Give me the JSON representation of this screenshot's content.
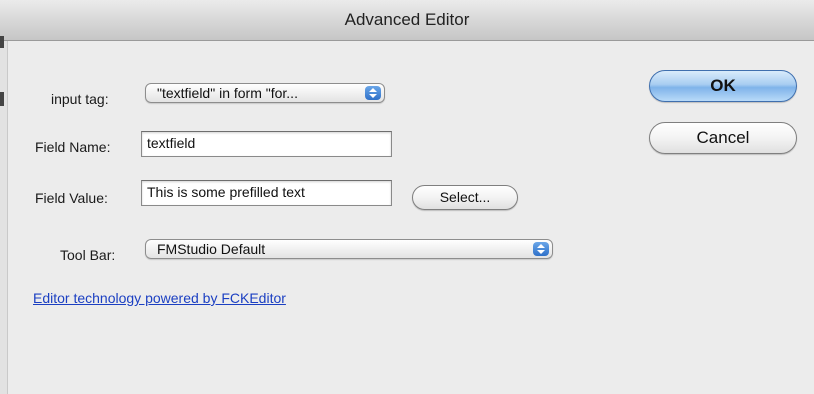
{
  "window": {
    "title": "Advanced Editor"
  },
  "form": {
    "input_tag": {
      "label": "input tag:",
      "value": "\"textfield\" in form \"for..."
    },
    "field_name": {
      "label": "Field Name:",
      "value": "textfield"
    },
    "field_value": {
      "label": "Field Value:",
      "value": "This is some prefilled text"
    },
    "tool_bar": {
      "label": "Tool Bar:",
      "value": "FMStudio Default"
    }
  },
  "buttons": {
    "ok": "OK",
    "cancel": "Cancel",
    "select": "Select..."
  },
  "footer": {
    "link": "Editor technology powered by FCKEditor"
  },
  "colors": {
    "link": "#1b3fc2",
    "default_button": "#7fb3ea",
    "window_bg": "#ececec"
  },
  "icons": [
    "popup-arrows-icon"
  ]
}
